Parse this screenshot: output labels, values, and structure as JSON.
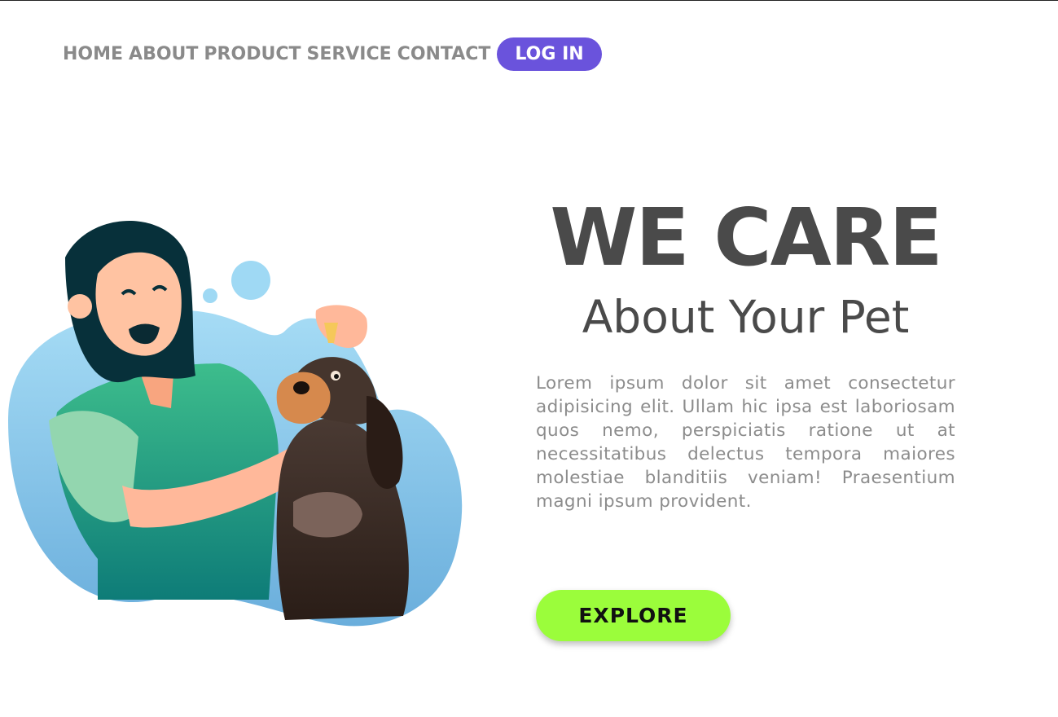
{
  "nav": {
    "items": [
      "HOME",
      "ABOUT",
      "PRODUCT",
      "SERVICE",
      "CONTACT"
    ],
    "login_label": "LOG IN"
  },
  "hero": {
    "headline": "WE CARE",
    "subheadline": "About Your Pet",
    "body": "Lorem ipsum dolor sit amet consectetur adipisicing elit. Ullam hic ipsa est laboriosam quos nemo, perspiciatis ratione ut at necessitatibus delectus tempora maiores molestiae blanditiis veniam! Praesentium magni ipsum provident.",
    "cta_label": "EXPLORE",
    "illustration": "woman-giving-eye-drops-to-dog-illustration"
  },
  "colors": {
    "accent": "#6a53dc",
    "cta": "#9bfd3b",
    "headline": "#4a4a4a",
    "body_text": "#8c8c8c",
    "nav_text": "#8a8a8a",
    "blob": "#8ecfee"
  }
}
